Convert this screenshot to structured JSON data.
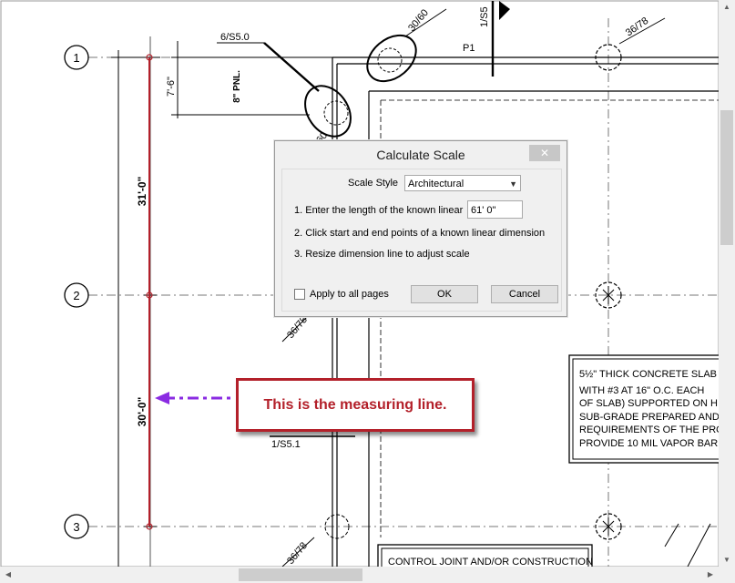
{
  "drawing": {
    "grid_labels": [
      "1",
      "2",
      "3"
    ],
    "dimension_top": "31'-0\"",
    "dimension_bottom": "30'-0\"",
    "dimension_small": "7'-6\"",
    "panel_label": "8\" PNL.",
    "detail_ref_1": "6/S5.0",
    "detail_ref_2": "30/60",
    "detail_ref_3": "1/S5",
    "detail_ref_4": "36/78",
    "detail_ref_5": "36/78",
    "detail_ref_6": "36/78",
    "detail_ref_7": "1/S5.1",
    "p1_label": "P1",
    "partial_60": "60",
    "note_lines": [
      "5½\" THICK CONCRETE SLAB",
      "WITH #3 AT 16\" O.C. EACH",
      "OF SLAB) SUPPORTED ON H",
      "SUB-GRADE PREPARED AND",
      "REQUIREMENTS OF THE PRO",
      "PROVIDE 10 MIL VAPOR BAR"
    ],
    "bottom_note": "CONTROL JOINT AND/OR CONSTRUCTION"
  },
  "dialog": {
    "title": "Calculate Scale",
    "close_symbol": "✕",
    "scale_style_label": "Scale Style",
    "scale_style_value": "Architectural",
    "step1": "1. Enter the length of the known linear",
    "length_value": "61' 0\"",
    "step2": "2. Click start and end points of a known linear dimension",
    "step3": "3. Resize dimension line to adjust scale",
    "apply_all": "Apply to all pages",
    "ok": "OK",
    "cancel": "Cancel"
  },
  "callout": {
    "text": "This is the measuring line."
  },
  "colors": {
    "measuring_line": "#b3202a",
    "arrow": "#8a2be2",
    "callout_border": "#b3202a"
  }
}
